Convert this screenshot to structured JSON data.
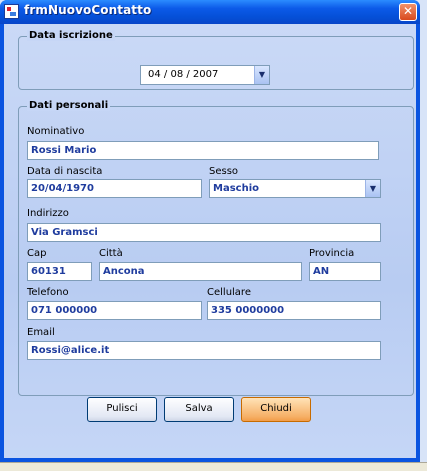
{
  "window": {
    "title": "frmNuovoContatto",
    "close_label": "✕"
  },
  "groups": {
    "registration": "Data iscrizione",
    "personal": "Dati personali"
  },
  "registration_date": {
    "value": "04 / 08 / 2007"
  },
  "fields": {
    "nominativo": {
      "label": "Nominativo",
      "value": "Rossi Mario"
    },
    "data_nascita": {
      "label": "Data di nascita",
      "value": "20/04/1970"
    },
    "sesso": {
      "label": "Sesso",
      "value": "Maschio"
    },
    "indirizzo": {
      "label": "Indirizzo",
      "value": "Via Gramsci"
    },
    "cap": {
      "label": "Cap",
      "value": "60131"
    },
    "citta": {
      "label": "Città",
      "value": "Ancona"
    },
    "provincia": {
      "label": "Provincia",
      "value": "AN"
    },
    "telefono": {
      "label": "Telefono",
      "value": "071 000000"
    },
    "cellulare": {
      "label": "Cellulare",
      "value": "335 0000000"
    },
    "email": {
      "label": "Email",
      "value": "Rossi@alice.it"
    }
  },
  "buttons": {
    "clear": "Pulisci",
    "save": "Salva",
    "close": "Chiudi"
  },
  "icons": {
    "app": "form-icon",
    "dropdown": "chevron-down-icon"
  }
}
